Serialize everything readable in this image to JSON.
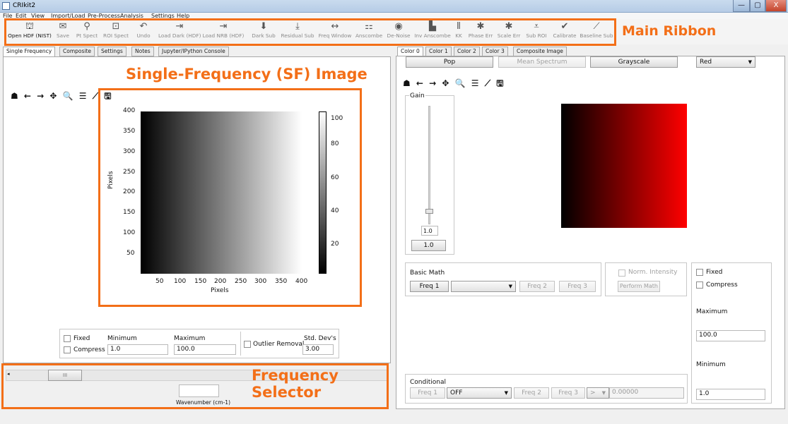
{
  "window": {
    "title": "CRIkit2",
    "min_glyph": "—",
    "max_glyph": "▢",
    "close_glyph": "X"
  },
  "menu": [
    "File",
    "Edit",
    "View",
    "Import/Load",
    "Pre-Process",
    "Analysis",
    "Settings",
    "Help"
  ],
  "ribbon": {
    "tools": [
      {
        "label": "Open HDF (NIST)",
        "icon": "open-hdf-icon",
        "glyph": "⛫"
      },
      {
        "label": "Save",
        "icon": "save-icon",
        "glyph": "✉"
      },
      {
        "label": "Pt Spect",
        "icon": "pin-icon",
        "glyph": "⚲"
      },
      {
        "label": "ROI Spect",
        "icon": "roi-icon",
        "glyph": "⊡"
      },
      {
        "label": "Undo",
        "icon": "undo-icon",
        "glyph": "↶"
      },
      {
        "label": "Load Dark (HDF)",
        "icon": "load-dark-icon",
        "glyph": "⇥"
      },
      {
        "label": "Load NRB (HDF)",
        "icon": "load-nrb-icon",
        "glyph": "⇥"
      },
      {
        "label": "Dark Sub",
        "icon": "dark-sub-icon",
        "glyph": "⬇"
      },
      {
        "label": "Residual Sub",
        "icon": "residual-sub-icon",
        "glyph": "⤓"
      },
      {
        "label": "Freq Window",
        "icon": "freq-window-icon",
        "glyph": "↔"
      },
      {
        "label": "Anscombe",
        "icon": "anscombe-icon",
        "glyph": "⚏"
      },
      {
        "label": "De-Noise",
        "icon": "denoise-icon",
        "glyph": "◉"
      },
      {
        "label": "Inv Anscombe",
        "icon": "inv-anscombe-icon",
        "glyph": "▙"
      },
      {
        "label": "KK",
        "icon": "kk-icon",
        "glyph": "⦀"
      },
      {
        "label": "Phase Err",
        "icon": "phase-err-icon",
        "glyph": "✱"
      },
      {
        "label": "Scale Err",
        "icon": "scale-err-icon",
        "glyph": "✱"
      },
      {
        "label": "Sub ROI",
        "icon": "sub-roi-icon",
        "glyph": "⩡"
      },
      {
        "label": "Calibrate",
        "icon": "calibrate-icon",
        "glyph": "✔"
      },
      {
        "label": "Baseline Sub",
        "icon": "baseline-sub-icon",
        "glyph": "⟋"
      }
    ]
  },
  "annotations": {
    "main_ribbon": "Main Ribbon",
    "sf_image": "Single-Frequency (SF) Image",
    "freq_selector_line1": "Frequency",
    "freq_selector_line2": "Selector"
  },
  "left_tabs": [
    "Single Frequency",
    "Composite",
    "Settings",
    "Notes",
    "Jupyter/IPython Console"
  ],
  "nav_icons": "☗ ← → ✥ 🔍 ☰ ⟋ 🖫",
  "sf_plot": {
    "xlabel": "Pixels",
    "ylabel": "Pixels",
    "xticks": [
      "50",
      "100",
      "150",
      "200",
      "250",
      "300",
      "350",
      "400"
    ],
    "yticks": [
      "400",
      "350",
      "300",
      "250",
      "200",
      "150",
      "100",
      "50"
    ],
    "cbar_ticks": [
      "100",
      "80",
      "60",
      "40",
      "20"
    ]
  },
  "sf_controls": {
    "fixed": "Fixed",
    "compress": "Compress",
    "minimum_label": "Minimum",
    "maximum_label": "Maximum",
    "minimum_value": "1.0",
    "maximum_value": "100.0",
    "outlier_removal": "Outlier Removal",
    "std_devs_label": "Std. Dev's",
    "std_devs_value": "3.00"
  },
  "freq_selector": {
    "scroll_grip": "III",
    "wavenumber_label": "Wavenumber (cm-1)",
    "wavenumber_value": ""
  },
  "right_tabs": [
    "Color 0",
    "Color 1",
    "Color 2",
    "Color 3",
    "Composite Image"
  ],
  "color_panel": {
    "pop": "Pop",
    "mean_spectrum": "Mean Spectrum",
    "grayscale": "Grayscale",
    "color_select": "Red",
    "gain_label": "Gain",
    "gain_value": "1.0",
    "gain_button": "1.0"
  },
  "basic_math": {
    "title": "Basic Math",
    "freq1": "Freq 1",
    "operation": "",
    "freq2": "Freq 2",
    "freq3": "Freq 3",
    "norm_intensity": "Norm. Intensity",
    "perform_math": "Perform Math"
  },
  "right_range": {
    "fixed": "Fixed",
    "compress": "Compress",
    "maximum_label": "Maximum",
    "maximum_value": "100.0",
    "minimum_label": "Minimum",
    "minimum_value": "1.0"
  },
  "conditional": {
    "title": "Conditional",
    "freq1": "Freq 1",
    "operation": "OFF",
    "freq2": "Freq 2",
    "freq3": "Freq 3",
    "comparator": ">",
    "threshold": "0.00000"
  }
}
